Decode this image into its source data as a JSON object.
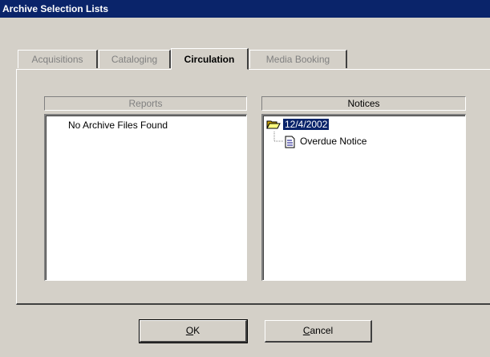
{
  "window": {
    "title": "Archive Selection Lists"
  },
  "tabs": [
    {
      "label": "Acquisitions",
      "active": false
    },
    {
      "label": "Cataloging",
      "active": false
    },
    {
      "label": "Circulation",
      "active": true
    },
    {
      "label": "Media Booking",
      "active": false
    }
  ],
  "reports": {
    "header": "Reports",
    "empty_message": "No Archive Files Found"
  },
  "notices": {
    "header": "Notices",
    "folder_label": "12/4/2002",
    "item_label": "Overdue Notice"
  },
  "buttons": {
    "ok_mnemonic": "O",
    "ok_rest": "K",
    "cancel_mnemonic": "C",
    "cancel_rest": "ancel"
  },
  "icons": {
    "folder": "open-folder-icon",
    "document": "document-icon"
  },
  "colors": {
    "titlebar": "#0a246a",
    "selection": "#0a246a",
    "face": "#d4d0c8"
  }
}
